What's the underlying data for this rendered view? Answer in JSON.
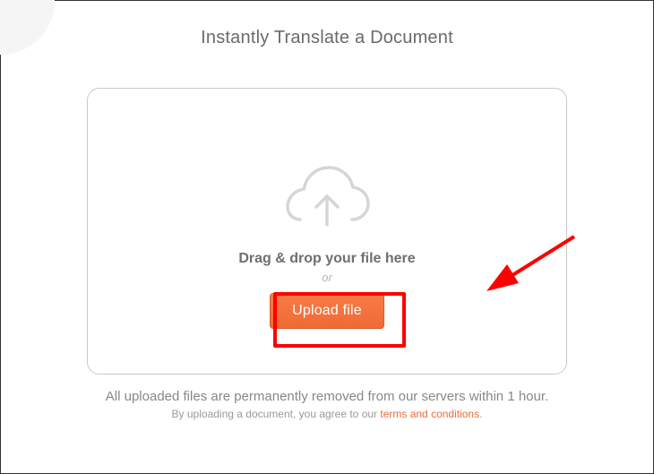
{
  "heading": "Instantly Translate a Document",
  "upload": {
    "drag_text": "Drag & drop your file here",
    "or_text": "or",
    "button_label": "Upload file"
  },
  "footer": {
    "line1": "All uploaded files are permanently removed from our servers within 1 hour.",
    "line2_prefix": "By uploading a document, you agree to our ",
    "terms_label": "terms and conditions",
    "line2_suffix": "."
  }
}
